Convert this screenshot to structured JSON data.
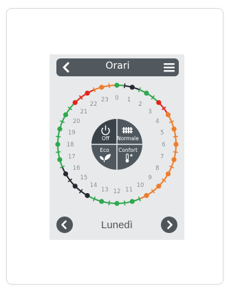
{
  "header": {
    "title": "Orari",
    "back_icon": "chevron-left-icon",
    "menu_icon": "hamburger-menu-icon"
  },
  "modes": {
    "off": "Off",
    "normal": "Normale",
    "eco": "Eco",
    "comfort": "Confort"
  },
  "footer": {
    "day": "Lunedì",
    "prev_icon": "chevron-left-icon",
    "next_icon": "chevron-right-icon"
  },
  "hours": [
    "0",
    "1",
    "2",
    "3",
    "4",
    "5",
    "6",
    "7",
    "8",
    "9",
    "10",
    "11",
    "12",
    "13",
    "14",
    "15",
    "16",
    "17",
    "18",
    "19",
    "20",
    "21",
    "22",
    "23"
  ],
  "colors": {
    "dark": "#3b434a",
    "segment": "#4f585e",
    "eco_green": "#2fa84f",
    "normal_black": "#252a30",
    "comfort_red": "#e2241b",
    "orange": "#ee7d2b",
    "device_bg": "#e8e9ea"
  },
  "schedule": [
    "green",
    "black",
    "black",
    "green",
    "green",
    "green",
    "red",
    "red",
    "orange",
    "orange",
    "orange",
    "orange",
    "orange",
    "orange",
    "orange",
    "orange",
    "orange",
    "orange",
    "orange",
    "orange",
    "orange",
    "green",
    "green",
    "green",
    "green",
    "green",
    "green",
    "green",
    "black",
    "black",
    "black",
    "black",
    "black",
    "green",
    "green",
    "green",
    "green",
    "green",
    "green",
    "green",
    "green",
    "green",
    "red",
    "red",
    "red",
    "orange",
    "orange",
    "orange"
  ]
}
